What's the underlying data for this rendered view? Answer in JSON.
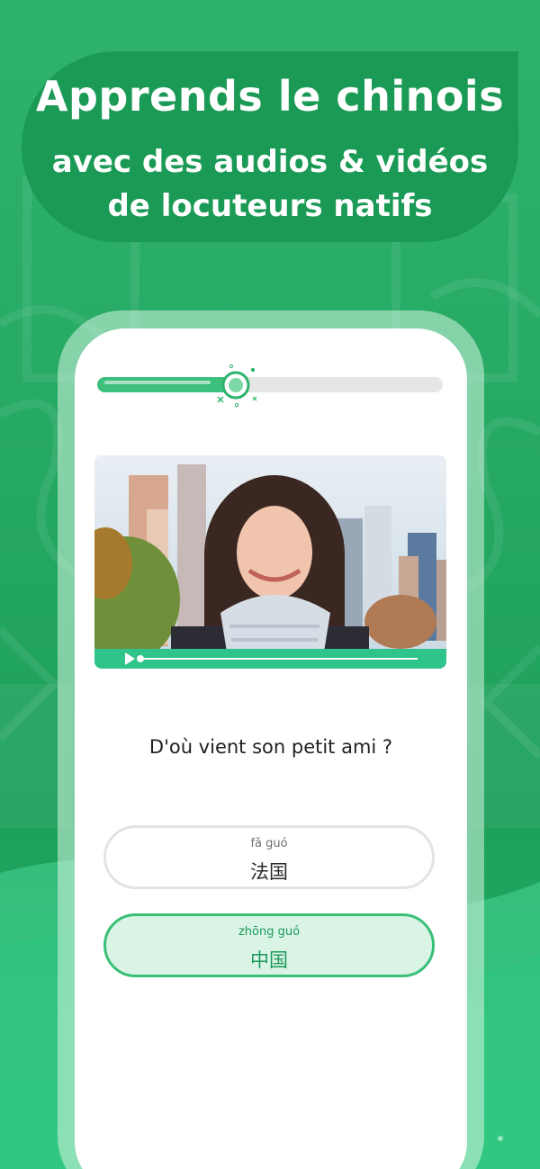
{
  "hero": {
    "line1": "Apprends le chinois",
    "line2": "avec des audios & vidéos",
    "line3": "de locuteurs natifs"
  },
  "lesson": {
    "progress_fraction": 0.4,
    "video": {
      "state": "paused",
      "icon": "play-icon",
      "position_fraction": 0.0
    },
    "question": "D'où vient son petit ami ?",
    "options": [
      {
        "pinyin": "fǎ guó",
        "hanzi": "法国",
        "selected": false
      },
      {
        "pinyin": "zhōng guó",
        "hanzi": "中国",
        "selected": true
      }
    ]
  },
  "colors": {
    "brand_green": "#25a862",
    "accent_green": "#3dc07c",
    "selected_border": "#39bf78",
    "selected_fill": "#d9f3e5"
  }
}
